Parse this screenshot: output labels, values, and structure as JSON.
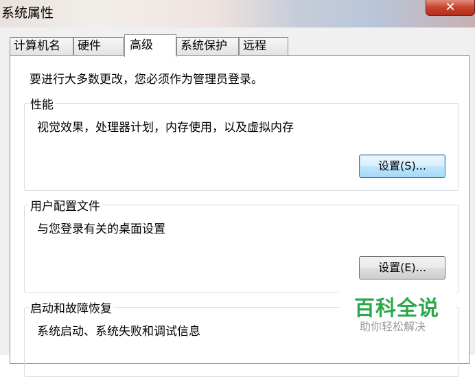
{
  "window": {
    "title": "系统属性",
    "close_glyph": "✕"
  },
  "tabs": [
    {
      "label": "计算机名",
      "active": false
    },
    {
      "label": "硬件",
      "active": false
    },
    {
      "label": "高级",
      "active": true
    },
    {
      "label": "系统保护",
      "active": false
    },
    {
      "label": "远程",
      "active": false
    }
  ],
  "advanced": {
    "admin_notice": "要进行大多数更改，您必须作为管理员登录。",
    "performance": {
      "legend": "性能",
      "description": "视觉效果，处理器计划，内存使用，以及虚拟内存",
      "settings_button": "设置(S)..."
    },
    "user_profiles": {
      "legend": "用户配置文件",
      "description": "与您登录有关的桌面设置",
      "settings_button": "设置(E)..."
    },
    "startup_recovery": {
      "legend": "启动和故障恢复",
      "description": "系统启动、系统失败和调试信息"
    }
  },
  "watermark": {
    "main": "百科全说",
    "sub": "助你轻松解决"
  }
}
